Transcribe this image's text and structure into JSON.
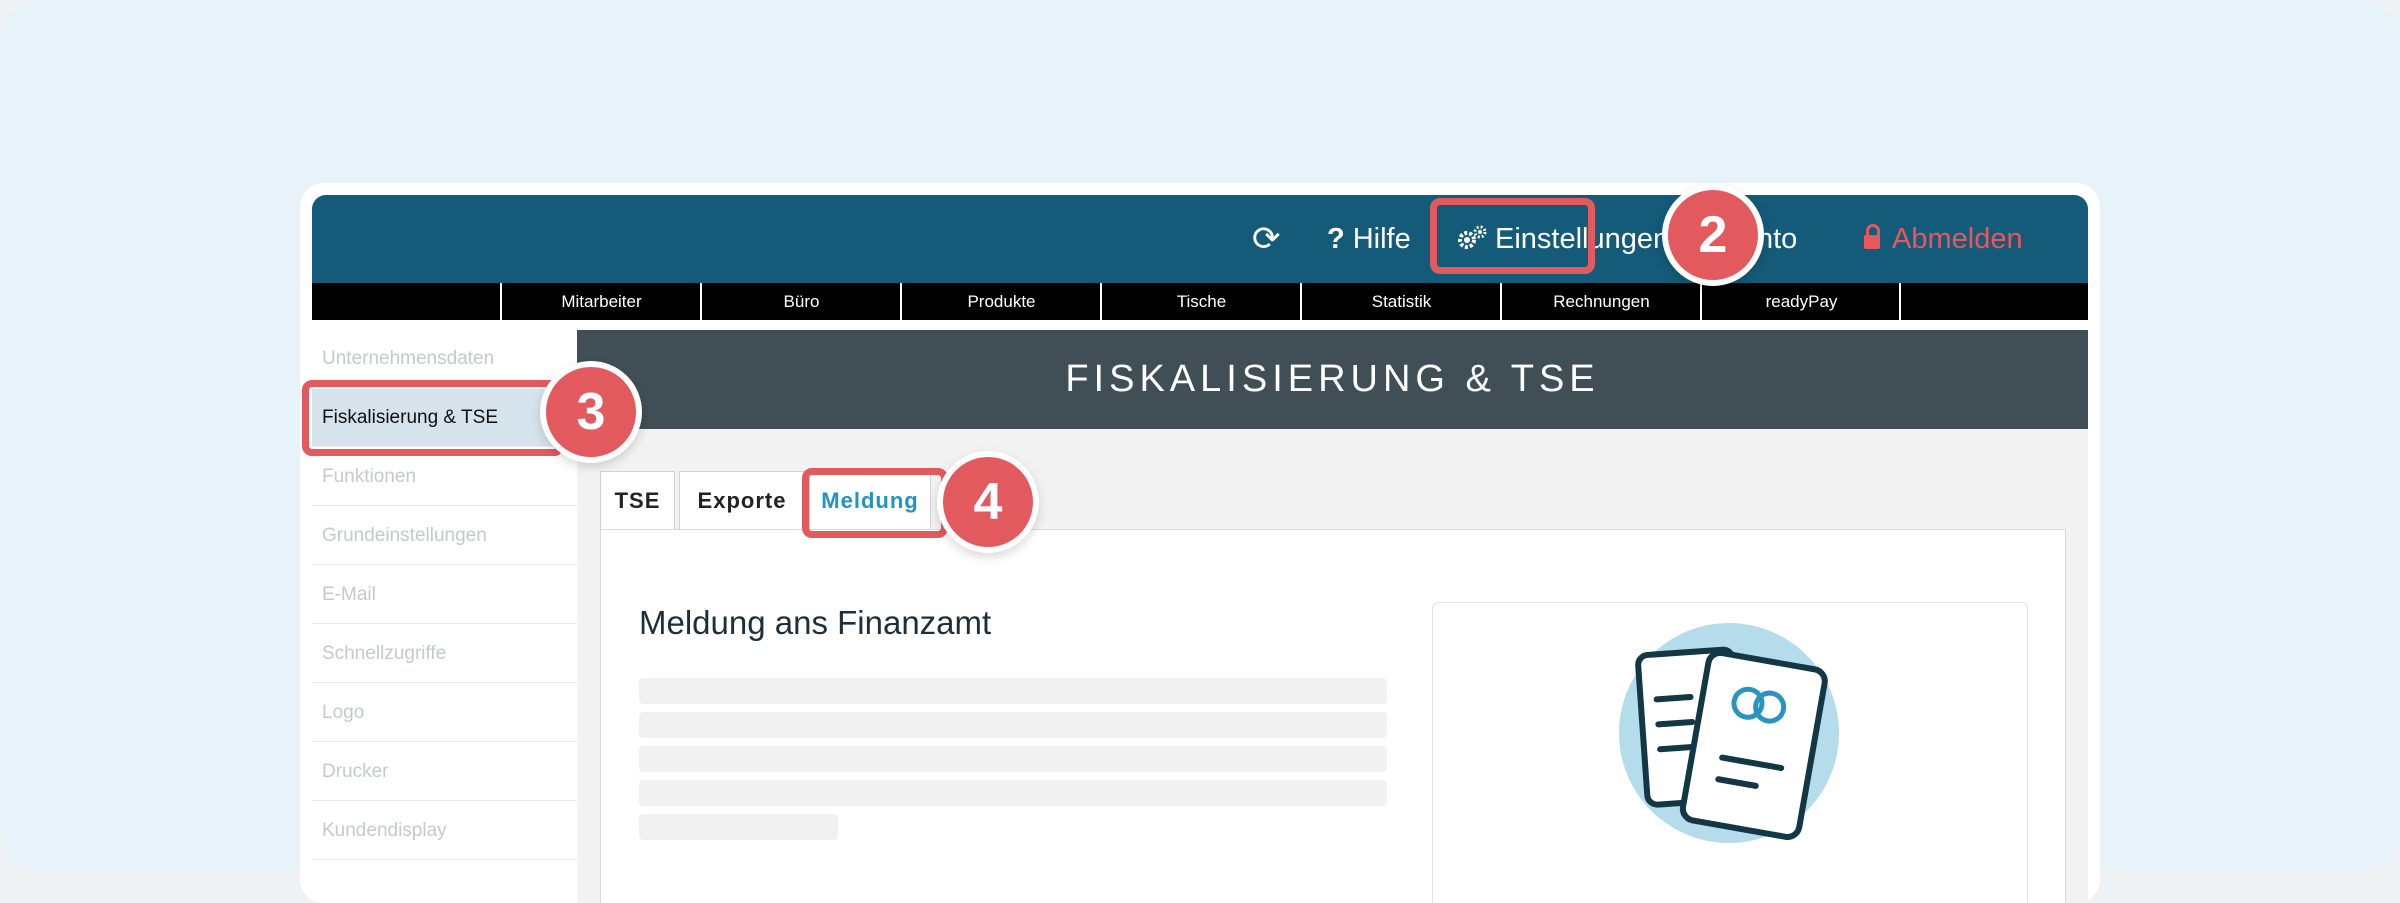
{
  "topbar": {
    "refresh_icon": "refresh-icon",
    "help_label": "Hilfe",
    "settings_label": "Einstellungen",
    "account_label": "nto",
    "logout_label": "Abmelden"
  },
  "nav": {
    "items": [
      "Mitarbeiter",
      "Büro",
      "Produkte",
      "Tische",
      "Statistik",
      "Rechnungen",
      "readyPay"
    ]
  },
  "sidebar": {
    "items": [
      {
        "label": "Unternehmensdaten"
      },
      {
        "label": "Fiskalisierung & TSE"
      },
      {
        "label": "Funktionen"
      },
      {
        "label": "Grundeinstellungen"
      },
      {
        "label": "E-Mail"
      },
      {
        "label": "Schnellzugriffe"
      },
      {
        "label": "Logo"
      },
      {
        "label": "Drucker"
      },
      {
        "label": "Kundendisplay"
      }
    ]
  },
  "main": {
    "header_title": "FISKALISIERUNG & TSE",
    "tabs": [
      {
        "label": "TSE"
      },
      {
        "label": "Exporte"
      },
      {
        "label": "Meldung"
      }
    ],
    "panel_title": "Meldung ans Finanzamt"
  },
  "badges": {
    "settings": "2",
    "sidebar": "3",
    "tab": "4"
  },
  "colors": {
    "topbar": "#135b79",
    "highlight": "#e35a5e",
    "header": "#3f4f55",
    "active_tab": "#2094c6",
    "logout": "#e8575c"
  }
}
